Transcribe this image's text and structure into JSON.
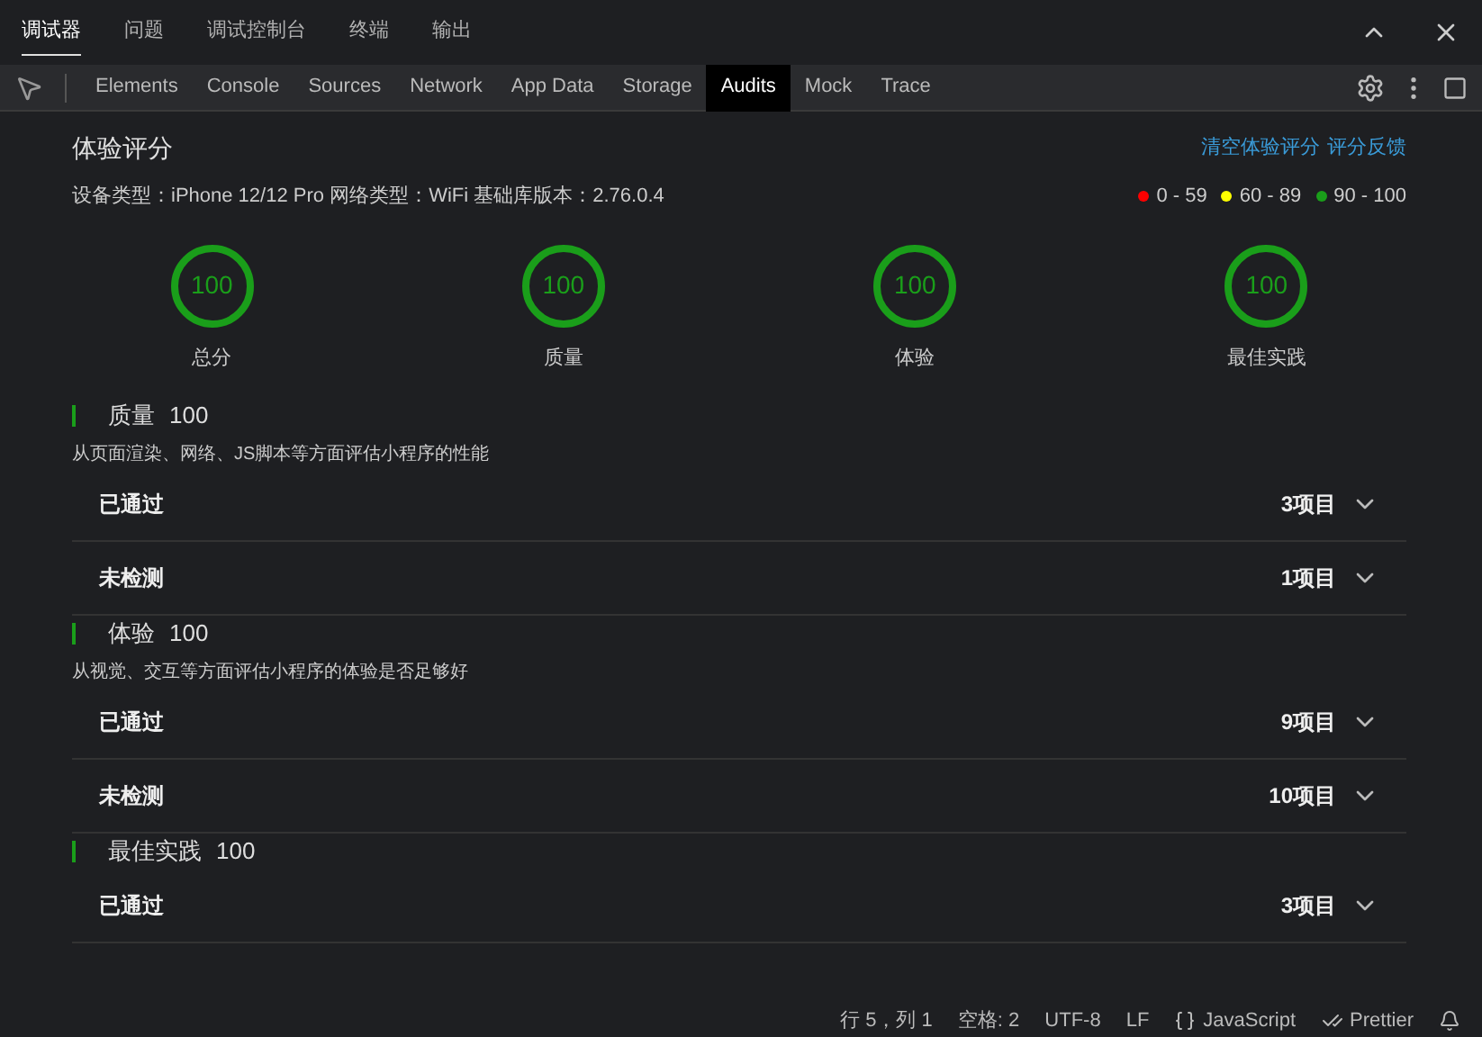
{
  "panel_tabs": [
    {
      "label": "调试器",
      "selected": true
    },
    {
      "label": "问题",
      "selected": false
    },
    {
      "label": "调试控制台",
      "selected": false
    },
    {
      "label": "终端",
      "selected": false
    },
    {
      "label": "输出",
      "selected": false
    }
  ],
  "devtools_tabs": [
    {
      "label": "Elements",
      "selected": false
    },
    {
      "label": "Console",
      "selected": false
    },
    {
      "label": "Sources",
      "selected": false
    },
    {
      "label": "Network",
      "selected": false
    },
    {
      "label": "App Data",
      "selected": false
    },
    {
      "label": "Storage",
      "selected": false
    },
    {
      "label": "Audits",
      "selected": true
    },
    {
      "label": "Mock",
      "selected": false
    },
    {
      "label": "Trace",
      "selected": false
    }
  ],
  "audit": {
    "title": "体验评分",
    "links": [
      "清空体验评分",
      "评分反馈"
    ],
    "device_info": "设备类型：iPhone 12/12 Pro 网络类型：WiFi 基础库版本：2.76.0.4",
    "legend": [
      {
        "label": "0 - 59",
        "color": "#ff0000"
      },
      {
        "label": "60 - 89",
        "color": "#ffff00"
      },
      {
        "label": "90 - 100",
        "color": "#1a9e1a"
      }
    ],
    "scores": [
      {
        "value": "100",
        "label": "总分",
        "color": "#1a9e1a"
      },
      {
        "value": "100",
        "label": "质量",
        "color": "#1a9e1a"
      },
      {
        "value": "100",
        "label": "体验",
        "color": "#1a9e1a"
      },
      {
        "value": "100",
        "label": "最佳实践",
        "color": "#1a9e1a"
      }
    ],
    "sections": [
      {
        "name": "质量",
        "score": "100",
        "description": "从页面渲染、网络、JS脚本等方面评估小程序的性能",
        "groups": [
          {
            "label": "已通过",
            "count": "3项目"
          },
          {
            "label": "未检测",
            "count": "1项目"
          }
        ]
      },
      {
        "name": "体验",
        "score": "100",
        "description": "从视觉、交互等方面评估小程序的体验是否足够好",
        "groups": [
          {
            "label": "已通过",
            "count": "9项目"
          },
          {
            "label": "未检测",
            "count": "10项目"
          }
        ]
      },
      {
        "name": "最佳实践",
        "score": "100",
        "groups": [
          {
            "label": "已通过",
            "count": "3项目"
          }
        ]
      }
    ]
  },
  "status_bar": {
    "cursor": "行 5，列 1",
    "spaces": "空格: 2",
    "encoding": "UTF-8",
    "eol": "LF",
    "language": "JavaScript",
    "formatter": "Prettier"
  }
}
